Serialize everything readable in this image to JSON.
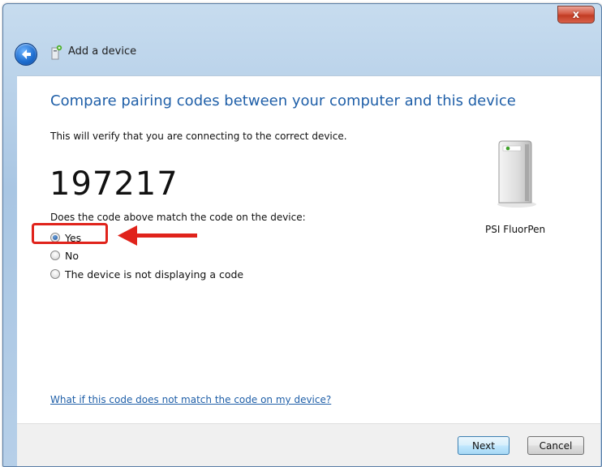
{
  "window": {
    "title": "Add a device",
    "close_glyph": "x"
  },
  "main": {
    "heading": "Compare pairing codes between your computer and this device",
    "subtext": "This will verify that you are connecting to the correct device.",
    "code": "197217",
    "question": "Does the code above match the code on the device:",
    "options": [
      {
        "label": "Yes",
        "checked": true
      },
      {
        "label": "No",
        "checked": false
      },
      {
        "label": "The device is not displaying a code",
        "checked": false
      }
    ],
    "help_link": "What if this code does not match the code on my device?"
  },
  "device": {
    "name": "PSI FluorPen",
    "icon": "device-tower-icon"
  },
  "footer": {
    "next_label": "Next",
    "cancel_label": "Cancel"
  },
  "colors": {
    "heading": "#1f5fa8",
    "highlight": "#e0231b"
  }
}
